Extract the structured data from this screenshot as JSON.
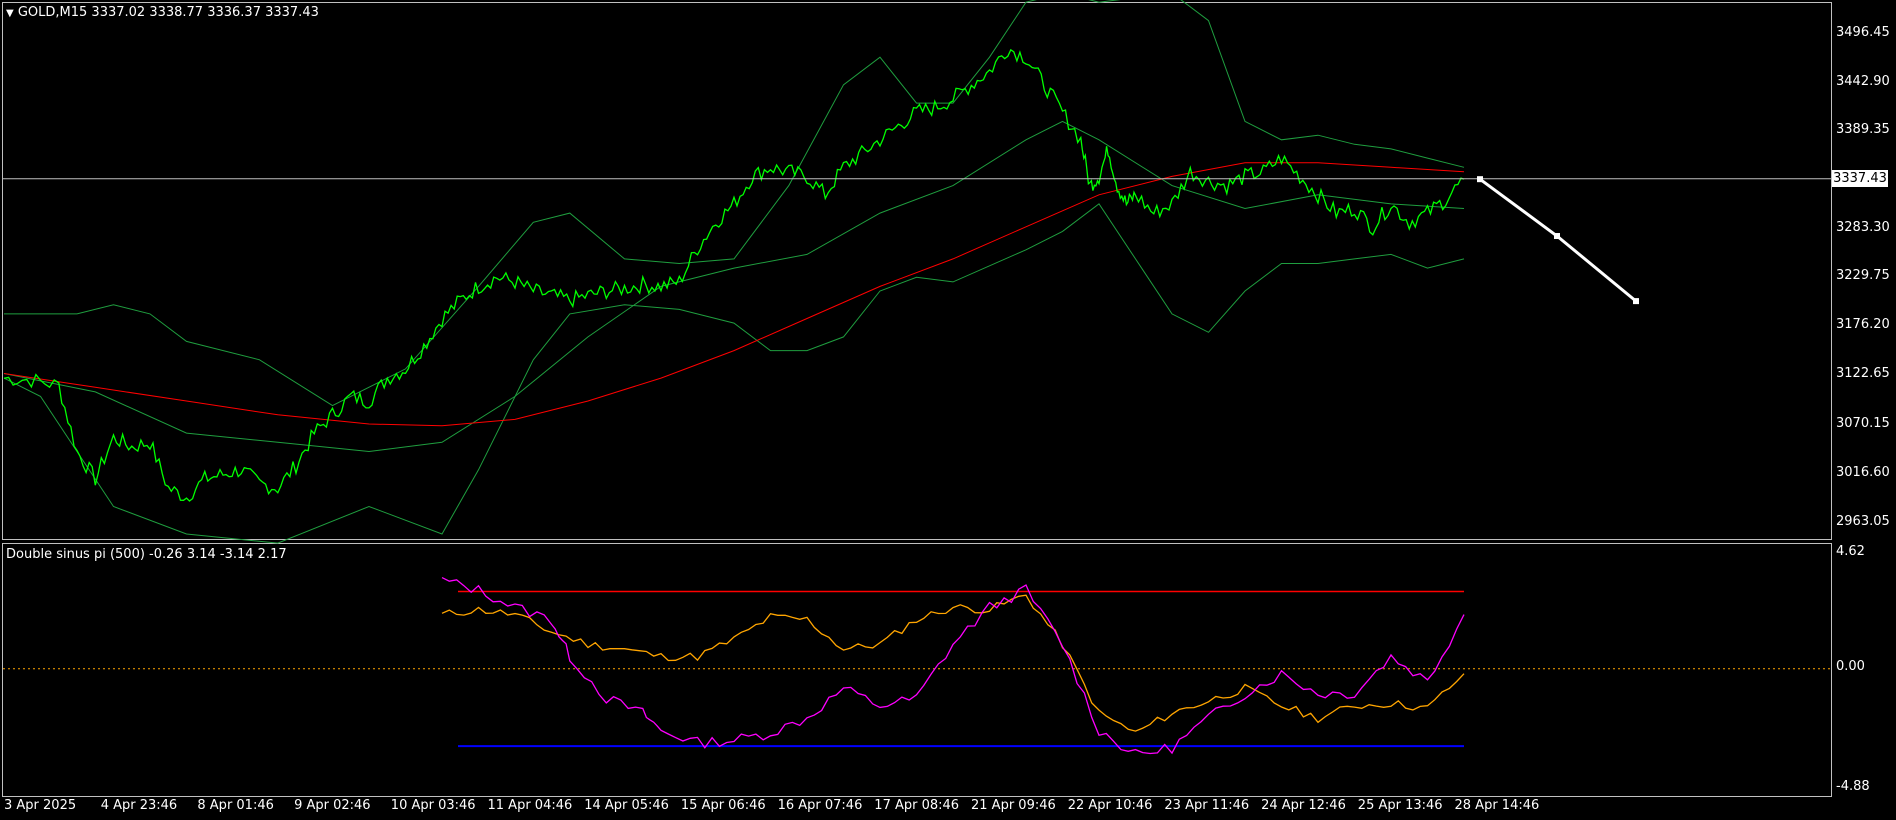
{
  "main_header": {
    "arrow": "▼",
    "text": "GOLD,M15  3337.02 3338.77 3336.37 3337.43"
  },
  "price_axis": [
    "3496.45",
    "3442.90",
    "3389.35",
    "3283.30",
    "3229.75",
    "3176.20",
    "3122.65",
    "3070.15",
    "3016.60",
    "2963.05"
  ],
  "current_price": "3337.43",
  "indicator_header": "Double sinus pi (500) -0.26 3.14 -3.14 2.17",
  "indicator_axis": {
    "top": "4.62",
    "zero": "0.00",
    "bottom": "-4.88"
  },
  "time_axis": [
    "3 Apr 2025",
    "4 Apr 23:46",
    "8 Apr 01:46",
    "9 Apr 02:46",
    "10 Apr 03:46",
    "11 Apr 04:46",
    "14 Apr 05:46",
    "15 Apr 06:46",
    "16 Apr 07:46",
    "17 Apr 08:46",
    "21 Apr 09:46",
    "22 Apr 10:46",
    "23 Apr 11:46",
    "24 Apr 12:46",
    "25 Apr 13:46",
    "28 Apr 14:46"
  ],
  "colors": {
    "price_line": "#00ff00",
    "bands": "#1f9e3f",
    "ma_red": "#ff0000",
    "projection": "#ffffff",
    "ind_magenta": "#ff00ff",
    "ind_orange": "#ffa500",
    "level_red": "#ff0000",
    "level_blue": "#0000ff",
    "zero_dotted": "#ffa500",
    "frame": "#c0c0c0"
  },
  "chart_data": {
    "type": "line",
    "symbol": "GOLD",
    "timeframe": "M15",
    "ohlc_last": {
      "open": 3337.02,
      "high": 3338.77,
      "low": 3336.37,
      "close": 3337.43
    },
    "ylim": [
      2940,
      3520
    ],
    "price_path": [
      [
        0,
        3120
      ],
      [
        3,
        3118
      ],
      [
        6,
        3112
      ],
      [
        8,
        3040
      ],
      [
        10,
        3010
      ],
      [
        12,
        3055
      ],
      [
        14,
        3045
      ],
      [
        16,
        3050
      ],
      [
        18,
        3000
      ],
      [
        20,
        2990
      ],
      [
        22,
        3010
      ],
      [
        24,
        3015
      ],
      [
        26,
        3020
      ],
      [
        28,
        3005
      ],
      [
        30,
        3000
      ],
      [
        32,
        3025
      ],
      [
        34,
        3060
      ],
      [
        36,
        3080
      ],
      [
        38,
        3100
      ],
      [
        40,
        3095
      ],
      [
        42,
        3120
      ],
      [
        44,
        3130
      ],
      [
        46,
        3155
      ],
      [
        48,
        3185
      ],
      [
        50,
        3205
      ],
      [
        52,
        3220
      ],
      [
        54,
        3230
      ],
      [
        56,
        3225
      ],
      [
        58,
        3215
      ],
      [
        60,
        3210
      ],
      [
        62,
        3205
      ],
      [
        64,
        3210
      ],
      [
        66,
        3215
      ],
      [
        68,
        3218
      ],
      [
        70,
        3222
      ],
      [
        72,
        3220
      ],
      [
        74,
        3225
      ],
      [
        76,
        3262
      ],
      [
        78,
        3290
      ],
      [
        80,
        3310
      ],
      [
        82,
        3340
      ],
      [
        84,
        3350
      ],
      [
        86,
        3345
      ],
      [
        88,
        3340
      ],
      [
        90,
        3320
      ],
      [
        92,
        3350
      ],
      [
        94,
        3365
      ],
      [
        96,
        3380
      ],
      [
        98,
        3395
      ],
      [
        100,
        3410
      ],
      [
        102,
        3415
      ],
      [
        104,
        3425
      ],
      [
        106,
        3440
      ],
      [
        108,
        3455
      ],
      [
        110,
        3480
      ],
      [
        112,
        3470
      ],
      [
        114,
        3440
      ],
      [
        116,
        3410
      ],
      [
        118,
        3380
      ],
      [
        119,
        3330
      ],
      [
        120,
        3340
      ],
      [
        121,
        3370
      ],
      [
        122,
        3330
      ],
      [
        123,
        3310
      ],
      [
        124,
        3320
      ],
      [
        126,
        3300
      ],
      [
        128,
        3310
      ],
      [
        130,
        3345
      ],
      [
        132,
        3335
      ],
      [
        134,
        3330
      ],
      [
        136,
        3340
      ],
      [
        138,
        3345
      ],
      [
        140,
        3360
      ],
      [
        142,
        3340
      ],
      [
        144,
        3320
      ],
      [
        146,
        3300
      ],
      [
        148,
        3305
      ],
      [
        150,
        3285
      ],
      [
        152,
        3310
      ],
      [
        154,
        3290
      ],
      [
        156,
        3300
      ],
      [
        158,
        3315
      ],
      [
        160,
        3337
      ]
    ],
    "ma_path": [
      [
        0,
        3125
      ],
      [
        10,
        3110
      ],
      [
        20,
        3095
      ],
      [
        30,
        3080
      ],
      [
        40,
        3070
      ],
      [
        48,
        3068
      ],
      [
        56,
        3075
      ],
      [
        64,
        3095
      ],
      [
        72,
        3120
      ],
      [
        80,
        3150
      ],
      [
        88,
        3185
      ],
      [
        96,
        3220
      ],
      [
        104,
        3250
      ],
      [
        112,
        3285
      ],
      [
        120,
        3320
      ],
      [
        128,
        3340
      ],
      [
        136,
        3355
      ],
      [
        144,
        3355
      ],
      [
        152,
        3350
      ],
      [
        160,
        3345
      ]
    ],
    "upper_band": [
      [
        0,
        3190
      ],
      [
        8,
        3190
      ],
      [
        12,
        3200
      ],
      [
        16,
        3190
      ],
      [
        20,
        3160
      ],
      [
        28,
        3140
      ],
      [
        36,
        3090
      ],
      [
        44,
        3130
      ],
      [
        52,
        3220
      ],
      [
        58,
        3290
      ],
      [
        62,
        3300
      ],
      [
        68,
        3250
      ],
      [
        74,
        3245
      ],
      [
        80,
        3250
      ],
      [
        86,
        3330
      ],
      [
        92,
        3440
      ],
      [
        96,
        3470
      ],
      [
        100,
        3420
      ],
      [
        104,
        3420
      ],
      [
        108,
        3470
      ],
      [
        112,
        3530
      ],
      [
        116,
        3540
      ],
      [
        120,
        3530
      ],
      [
        128,
        3540
      ],
      [
        132,
        3510
      ],
      [
        136,
        3400
      ],
      [
        140,
        3380
      ],
      [
        144,
        3385
      ],
      [
        148,
        3375
      ],
      [
        152,
        3370
      ],
      [
        156,
        3360
      ],
      [
        160,
        3350
      ]
    ],
    "lower_band": [
      [
        0,
        3120
      ],
      [
        4,
        3100
      ],
      [
        8,
        3040
      ],
      [
        12,
        2980
      ],
      [
        20,
        2950
      ],
      [
        30,
        2940
      ],
      [
        40,
        2980
      ],
      [
        48,
        2950
      ],
      [
        52,
        3020
      ],
      [
        58,
        3140
      ],
      [
        62,
        3190
      ],
      [
        68,
        3200
      ],
      [
        74,
        3195
      ],
      [
        80,
        3180
      ],
      [
        84,
        3150
      ],
      [
        88,
        3150
      ],
      [
        92,
        3165
      ],
      [
        96,
        3215
      ],
      [
        100,
        3230
      ],
      [
        104,
        3225
      ],
      [
        112,
        3260
      ],
      [
        116,
        3280
      ],
      [
        120,
        3310
      ],
      [
        124,
        3250
      ],
      [
        128,
        3190
      ],
      [
        132,
        3170
      ],
      [
        136,
        3215
      ],
      [
        140,
        3245
      ],
      [
        144,
        3245
      ],
      [
        148,
        3250
      ],
      [
        152,
        3255
      ],
      [
        156,
        3240
      ],
      [
        160,
        3250
      ]
    ],
    "mid_band": [
      [
        0,
        3125
      ],
      [
        10,
        3105
      ],
      [
        20,
        3060
      ],
      [
        30,
        3050
      ],
      [
        40,
        3040
      ],
      [
        48,
        3050
      ],
      [
        56,
        3100
      ],
      [
        64,
        3165
      ],
      [
        72,
        3220
      ],
      [
        80,
        3240
      ],
      [
        88,
        3255
      ],
      [
        96,
        3300
      ],
      [
        104,
        3330
      ],
      [
        112,
        3380
      ],
      [
        116,
        3400
      ],
      [
        120,
        3380
      ],
      [
        128,
        3330
      ],
      [
        136,
        3305
      ],
      [
        144,
        3320
      ],
      [
        152,
        3310
      ],
      [
        160,
        3305
      ]
    ],
    "projection": [
      [
        3337,
        "28 Apr 14:46"
      ],
      [
        3275,
        "next"
      ],
      [
        3200,
        "next2"
      ]
    ],
    "indicator": {
      "name": "Double sinus pi",
      "period": 500,
      "values": [
        -0.26,
        3.14,
        -3.14,
        2.17
      ],
      "ylim": [
        -4.88,
        4.62
      ],
      "levels": [
        3.14,
        0.0,
        -3.14
      ],
      "magenta": [
        [
          48,
          3.6
        ],
        [
          52,
          3.2
        ],
        [
          56,
          2.5
        ],
        [
          60,
          2.0
        ],
        [
          62,
          0.5
        ],
        [
          66,
          -1.2
        ],
        [
          70,
          -1.8
        ],
        [
          72,
          -2.5
        ],
        [
          76,
          -3.0
        ],
        [
          80,
          -2.9
        ],
        [
          84,
          -2.6
        ],
        [
          88,
          -2.0
        ],
        [
          92,
          -0.8
        ],
        [
          96,
          -1.5
        ],
        [
          100,
          -1.2
        ],
        [
          104,
          1.0
        ],
        [
          108,
          2.5
        ],
        [
          112,
          3.2
        ],
        [
          116,
          1.0
        ],
        [
          120,
          -2.5
        ],
        [
          124,
          -3.5
        ],
        [
          128,
          -3.2
        ],
        [
          132,
          -2.0
        ],
        [
          136,
          -1.0
        ],
        [
          140,
          -0.2
        ],
        [
          144,
          -1.0
        ],
        [
          148,
          -1.0
        ],
        [
          152,
          0.5
        ],
        [
          156,
          -0.5
        ],
        [
          160,
          2.2
        ]
      ],
      "orange": [
        [
          48,
          2.2
        ],
        [
          52,
          2.4
        ],
        [
          56,
          2.2
        ],
        [
          60,
          1.5
        ],
        [
          64,
          1.0
        ],
        [
          68,
          0.8
        ],
        [
          72,
          0.5
        ],
        [
          76,
          0.5
        ],
        [
          80,
          1.2
        ],
        [
          84,
          2.1
        ],
        [
          88,
          2.0
        ],
        [
          92,
          0.8
        ],
        [
          96,
          1.0
        ],
        [
          100,
          2.0
        ],
        [
          104,
          2.5
        ],
        [
          108,
          2.4
        ],
        [
          112,
          3.0
        ],
        [
          116,
          1.0
        ],
        [
          120,
          -1.8
        ],
        [
          124,
          -2.6
        ],
        [
          128,
          -1.8
        ],
        [
          132,
          -1.3
        ],
        [
          136,
          -0.8
        ],
        [
          140,
          -1.5
        ],
        [
          144,
          -2.0
        ],
        [
          148,
          -1.5
        ],
        [
          152,
          -1.4
        ],
        [
          156,
          -1.6
        ],
        [
          160,
          -0.2
        ]
      ]
    }
  }
}
